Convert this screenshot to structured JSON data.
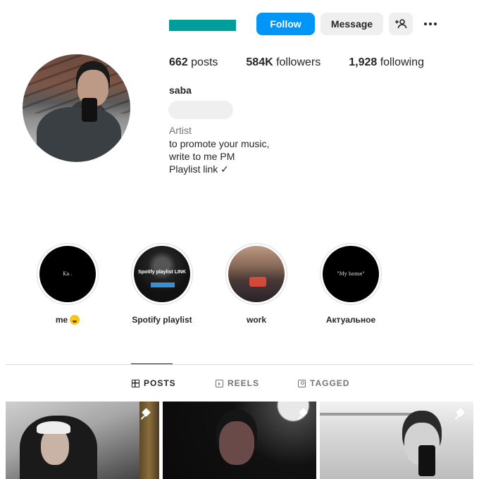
{
  "colors": {
    "follow_blue": "#0095f6",
    "redaction_teal": "#009e9a",
    "secondary_button": "#efefef",
    "muted_text": "#737373"
  },
  "header": {
    "follow_label": "Follow",
    "message_label": "Message",
    "add_user_icon": "person-add-icon",
    "more_icon": "more-horizontal-icon"
  },
  "stats": [
    {
      "count": "662",
      "label": " posts"
    },
    {
      "count": "584K",
      "label": " followers"
    },
    {
      "count": "1,928",
      "label": " following"
    }
  ],
  "profile": {
    "username": "saba",
    "category": "Artist",
    "bio_lines": [
      "to promote your music,",
      "write to me PM",
      "Playlist link ✓"
    ]
  },
  "highlights": [
    {
      "label": "me",
      "emoji": "grinning-face",
      "cover_text": "Ka ."
    },
    {
      "label": "Spotify playlist",
      "cover_text": "Spotify playlist LINK"
    },
    {
      "label": "work",
      "cover_text": ""
    },
    {
      "label": "Актуальное",
      "cover_text": "\"My home\""
    }
  ],
  "tabs": [
    {
      "label": "POSTS",
      "icon": "grid-icon",
      "active": true
    },
    {
      "label": "REELS",
      "icon": "reels-icon",
      "active": false
    },
    {
      "label": "TAGGED",
      "icon": "tagged-icon",
      "active": false
    }
  ],
  "posts": [
    {
      "pinned": true,
      "icon": "pin-icon"
    },
    {
      "pinned": true,
      "icon": "pin-icon"
    },
    {
      "pinned": true,
      "icon": "pin-icon"
    }
  ]
}
